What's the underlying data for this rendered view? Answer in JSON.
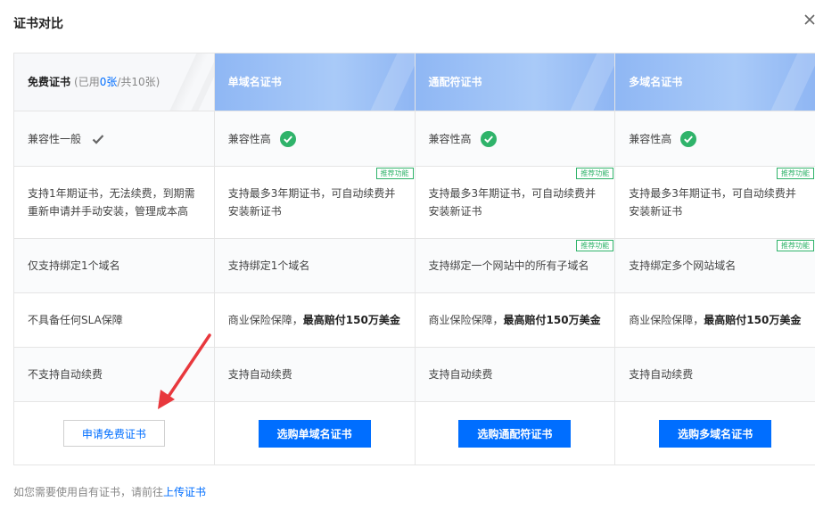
{
  "dialog": {
    "title": "证书对比",
    "close_icon": "close-icon"
  },
  "header": {
    "free_title": "免费证书",
    "quota_open": "(已用",
    "quota_used": "0张",
    "quota_rest": "/共10张)",
    "single": "单域名证书",
    "wildcard": "通配符证书",
    "multi": "多域名证书"
  },
  "rows": {
    "compat": {
      "free": "兼容性一般",
      "free_icon": "check-gray-icon",
      "single": "兼容性高",
      "wildcard": "兼容性高",
      "multi": "兼容性高",
      "paid_icon": "check-green-icon"
    },
    "renew": {
      "free": "支持1年期证书，无法续费，到期需重新申请并手动安装，管理成本高",
      "single": "支持最多3年期证书，可自动续费并安装新证书",
      "wildcard": "支持最多3年期证书，可自动续费并安装新证书",
      "multi": "支持最多3年期证书，可自动续费并安装新证书",
      "tag": "推荐功能"
    },
    "domain": {
      "free": "仅支持绑定1个域名",
      "single": "支持绑定1个域名",
      "wildcard": "支持绑定一个网站中的所有子域名",
      "multi": "支持绑定多个网站域名",
      "tag": "推荐功能"
    },
    "sla": {
      "free": "不具备任何SLA保障",
      "paid_prefix": "商业保险保障，",
      "paid_bold": "最高赔付150万美金"
    },
    "auto": {
      "free": "不支持自动续费",
      "single": "支持自动续费",
      "wildcard": "支持自动续费",
      "multi": "支持自动续费"
    }
  },
  "actions": {
    "free": "申请免费证书",
    "single": "选购单域名证书",
    "wildcard": "选购通配符证书",
    "multi": "选购多域名证书"
  },
  "annotation": {
    "arrow_color": "#e8383d"
  },
  "footer": {
    "prefix": "如您需要使用自有证书，请前往",
    "link": "上传证书"
  },
  "colors": {
    "primary": "#006eff",
    "success": "#2fb36a",
    "header_blue": "#a9caf8"
  }
}
